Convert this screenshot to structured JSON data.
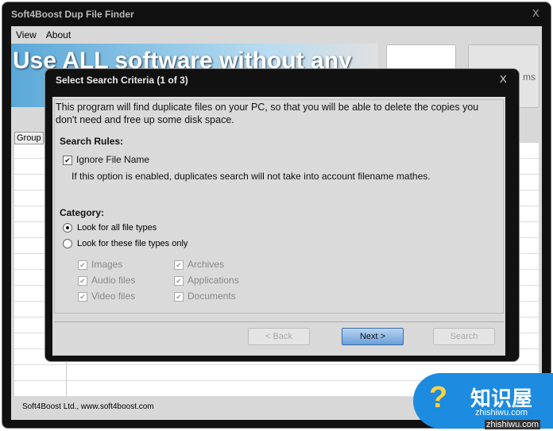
{
  "window": {
    "title": "Soft4Boost Dup File Finder",
    "close": "X"
  },
  "menu": [
    "View",
    "About"
  ],
  "banner": {
    "text": "Use ALL software without any"
  },
  "side_partial": "ms",
  "group_label": "Group",
  "status": "Soft4Boost Ltd., www.soft4boost.com",
  "dialog": {
    "title": "Select Search Criteria (1 of 3)",
    "close": "X",
    "intro": "This program will find duplicate files on your PC, so that you will be able to delete the copies you don't need and free up some disk space.",
    "rules_heading": "Search Rules:",
    "ignore_label": "Ignore File Name",
    "ignore_checked": true,
    "ignore_desc": "If this option is enabled, duplicates search will not take into account filename mathes.",
    "category_heading": "Category:",
    "radio_all": "Look for all file types",
    "radio_only": "Look for these file types only",
    "types": [
      "Images",
      "Archives",
      "Audio files",
      "Applications",
      "Video files",
      "Documents"
    ],
    "back": "< Back",
    "next": "Next >",
    "search": "Search"
  },
  "watermark": {
    "cn": "知识屋",
    "url": "zhishiwu.com",
    "url2": "zhishiwu.com"
  }
}
